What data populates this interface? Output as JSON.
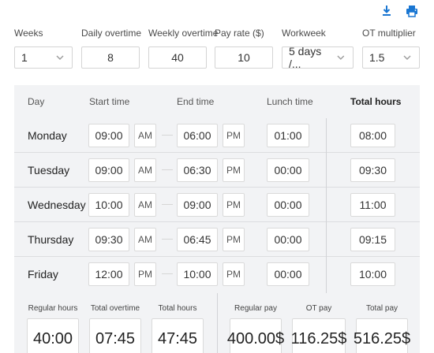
{
  "toolbar": {
    "download_icon": "download-icon",
    "print_icon": "print-icon",
    "accent": "#1976d2"
  },
  "settings": {
    "weeks": {
      "label": "Weeks",
      "value": "1"
    },
    "daily_overtime": {
      "label": "Daily overtime",
      "value": "8"
    },
    "weekly_overtime": {
      "label": "Weekly overtime",
      "value": "40"
    },
    "pay_rate": {
      "label": "Pay rate ($)",
      "value": "10"
    },
    "workweek": {
      "label": "Workweek",
      "value": "5 days /..."
    },
    "ot_multiplier": {
      "label": "OT multiplier",
      "value": "1.5"
    }
  },
  "table": {
    "headers": {
      "day": "Day",
      "start": "Start time",
      "end": "End time",
      "lunch": "Lunch time",
      "total": "Total hours"
    },
    "rows": [
      {
        "day": "Monday",
        "start": "09:00",
        "start_ampm": "AM",
        "end": "06:00",
        "end_ampm": "PM",
        "lunch": "01:00",
        "total": "08:00"
      },
      {
        "day": "Tuesday",
        "start": "09:00",
        "start_ampm": "AM",
        "end": "06:30",
        "end_ampm": "PM",
        "lunch": "00:00",
        "total": "09:30"
      },
      {
        "day": "Wednesday",
        "start": "10:00",
        "start_ampm": "AM",
        "end": "09:00",
        "end_ampm": "PM",
        "lunch": "00:00",
        "total": "11:00"
      },
      {
        "day": "Thursday",
        "start": "09:30",
        "start_ampm": "AM",
        "end": "06:45",
        "end_ampm": "PM",
        "lunch": "00:00",
        "total": "09:15"
      },
      {
        "day": "Friday",
        "start": "12:00",
        "start_ampm": "PM",
        "end": "10:00",
        "end_ampm": "PM",
        "lunch": "00:00",
        "total": "10:00"
      }
    ]
  },
  "summary": {
    "regular_hours": {
      "label": "Regular hours",
      "value": "40:00"
    },
    "total_overtime": {
      "label": "Total overtime",
      "value": "07:45"
    },
    "total_hours": {
      "label": "Total hours",
      "value": "47:45"
    },
    "regular_pay": {
      "label": "Regular pay",
      "value": "400.00$"
    },
    "ot_pay": {
      "label": "OT pay",
      "value": "116.25$"
    },
    "total_pay": {
      "label": "Total pay",
      "value": "516.25$"
    }
  }
}
